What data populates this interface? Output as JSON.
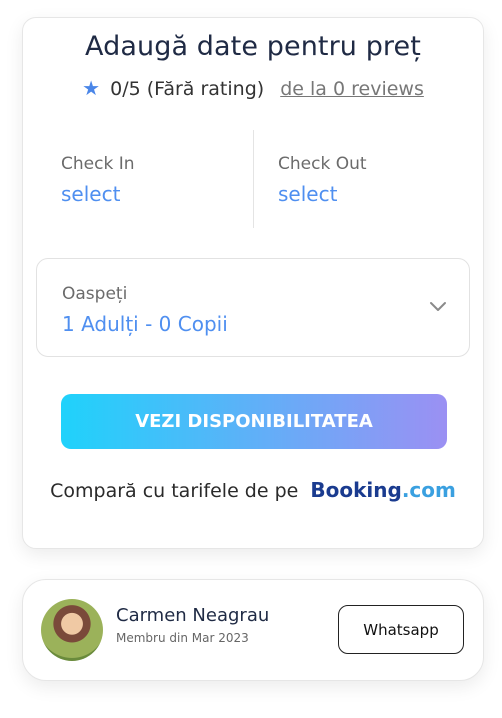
{
  "booking": {
    "title": "Adaugă date pentru preț",
    "rating_text": "0/5 (Fără rating)",
    "reviews_link": "de la 0 reviews",
    "check_in_label": "Check In",
    "check_in_value": "select",
    "check_out_label": "Check Out",
    "check_out_value": "select",
    "guests_label": "Oaspeți",
    "guests_value": "1 Adulți - 0 Copii",
    "cta_label": "VEZI DISPONIBILITATEA",
    "compare_text": "Compară cu tarifele de pe",
    "booking_brand": "Booking",
    "booking_brand_suffix": ".com"
  },
  "host": {
    "name": "Carmen Neagrau",
    "member_since": "Membru din Mar 2023",
    "whatsapp_label": "Whatsapp"
  },
  "colors": {
    "accent_blue": "#4f8ff0",
    "star": "#4a86e8",
    "gradient_start": "#1fd2fb",
    "gradient_end": "#9b90f3",
    "booking_navy": "#1a3b8f",
    "booking_dot": "#3aa0e0"
  },
  "icons": {
    "rating": "star-icon",
    "guests_dropdown": "chevron-down-icon",
    "host_avatar": "avatar"
  }
}
